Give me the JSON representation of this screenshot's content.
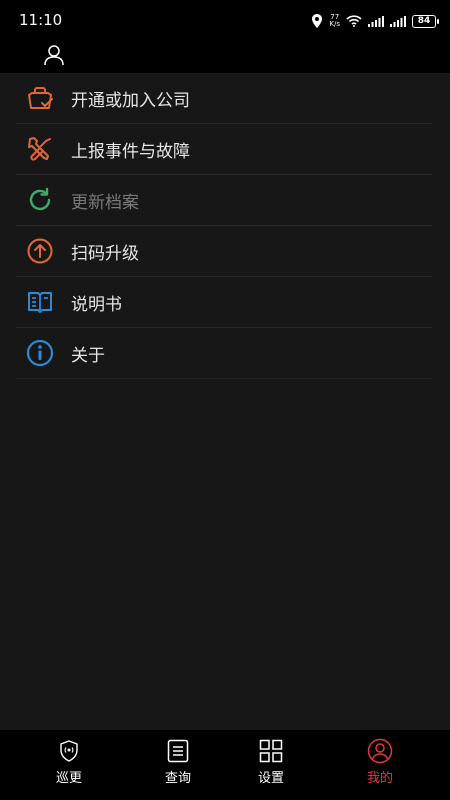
{
  "status_bar": {
    "time": "11:10",
    "speed_value": "77",
    "speed_unit": "K/s",
    "battery": "84"
  },
  "menu": {
    "items": [
      {
        "label": "开通或加入公司",
        "icon": "briefcase-check-icon",
        "color": "#e0673a"
      },
      {
        "label": "上报事件与故障",
        "icon": "wrench-screwdriver-icon",
        "color": "#e0673a"
      },
      {
        "label": "更新档案",
        "icon": "refresh-icon",
        "color": "#3faa6a",
        "disabled": true
      },
      {
        "label": "扫码升级",
        "icon": "arrow-up-circle-icon",
        "color": "#e0673a"
      },
      {
        "label": "说明书",
        "icon": "book-icon",
        "color": "#2e89d8"
      },
      {
        "label": "关于",
        "icon": "info-icon",
        "color": "#2e89d8"
      }
    ]
  },
  "tabbar": {
    "tabs": [
      {
        "label": "巡更",
        "icon": "shield-signal-icon"
      },
      {
        "label": "查询",
        "icon": "list-document-icon"
      },
      {
        "label": "设置",
        "icon": "grid-icon"
      },
      {
        "label": "我的",
        "icon": "user-circle-icon",
        "active": true
      }
    ],
    "active_color": "#e0393e"
  }
}
